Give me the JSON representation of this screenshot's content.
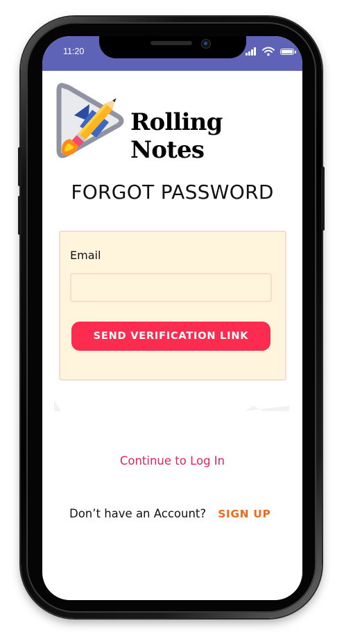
{
  "status_bar": {
    "time": "11:20",
    "color": "#5f63b8"
  },
  "icons": {
    "signal": "signal-icon",
    "wifi": "wifi-icon",
    "battery": "battery-icon",
    "logo": "rocket-pencil-icon"
  },
  "brand": {
    "app_name": "Rolling Notes"
  },
  "page": {
    "title": "FORGOT PASSWORD"
  },
  "form": {
    "email_label": "Email",
    "email_value": "",
    "email_placeholder": "",
    "send_button_label": "SEND VERIFICATION LINK"
  },
  "links": {
    "continue_login": "Continue to Log In",
    "no_account_text": "Don’t have an Account?",
    "signup_label": "SIGN UP"
  },
  "colors": {
    "primary_button": "#fb2c4f",
    "card_background": "#fff4dc",
    "continue_link": "#e0245e",
    "signup_link": "#ea6b1e"
  }
}
